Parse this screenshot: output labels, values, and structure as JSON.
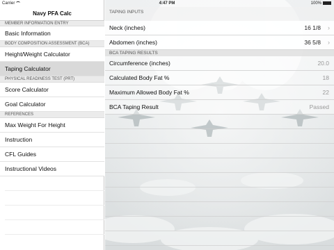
{
  "status_bar": {
    "carrier": "Carrier",
    "time": "4:47 PM",
    "battery": "100%"
  },
  "sidebar": {
    "title": "Navy PFA Calc",
    "sections": [
      {
        "header": "MEMBER INFORMATION ENTRY",
        "items": [
          {
            "label": "Basic Information"
          }
        ]
      },
      {
        "header": "BODY COMPOSITION ASSESSMENT (BCA)",
        "items": [
          {
            "label": "Height/Weight Calculator"
          },
          {
            "label": "Taping Calculator",
            "selected": true
          }
        ]
      },
      {
        "header": "PHYSICAL READINESS TEST (PRT)",
        "items": [
          {
            "label": "Score Calculator"
          },
          {
            "label": "Goal Calculator"
          }
        ]
      },
      {
        "header": "REFERENCES",
        "items": [
          {
            "label": "Max Weight For Height"
          },
          {
            "label": "Instruction"
          },
          {
            "label": "CFL Guides"
          },
          {
            "label": "Instructional Videos"
          }
        ]
      }
    ]
  },
  "detail": {
    "inputs_header": "TAPING INPUTS",
    "inputs": [
      {
        "label": "Neck (inches)",
        "value": "16 1/8"
      },
      {
        "label": "Abdomen (inches)",
        "value": "36 5/8"
      }
    ],
    "results_header": "BCA TAPING RESULTS",
    "results": [
      {
        "label": "Circumference (inches)",
        "value": "20.0"
      },
      {
        "label": "Calculated Body Fat %",
        "value": "18"
      },
      {
        "label": "Maximum Allowed Body Fat %",
        "value": "22"
      },
      {
        "label": "BCA Taping Result",
        "value": "Passed"
      }
    ]
  },
  "icons": {
    "chevron": "chevron-right-icon",
    "wifi": "wifi-icon",
    "battery": "battery-icon"
  },
  "colors": {
    "selected_row": "#d9d9d9",
    "section_header": "#ebebeb",
    "muted_value": "#999999"
  }
}
